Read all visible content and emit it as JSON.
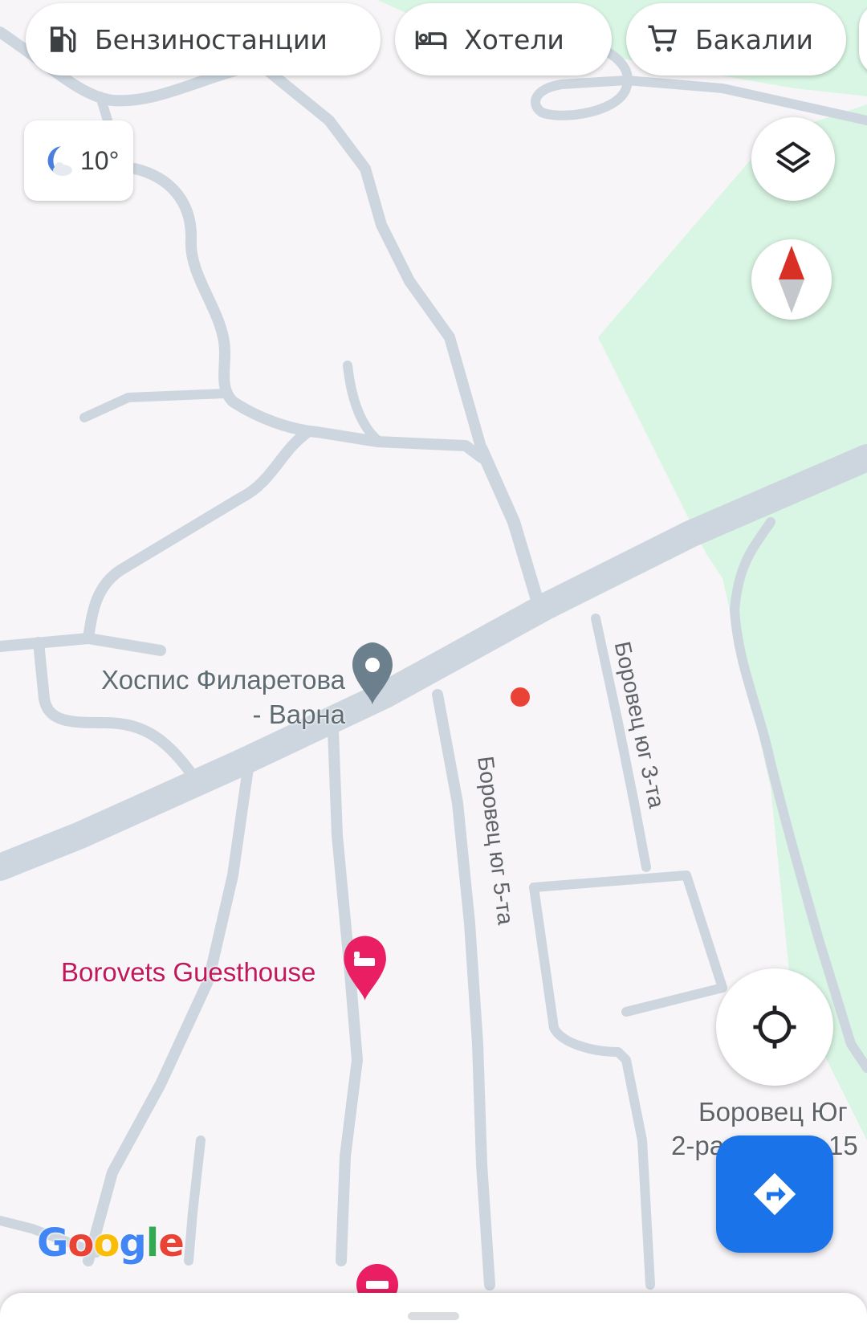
{
  "chips": [
    {
      "label": "Бензиностанции",
      "icon": "gas-station-icon"
    },
    {
      "label": "Хотели",
      "icon": "hotel-bed-icon"
    },
    {
      "label": "Бакалии",
      "icon": "shopping-cart-icon"
    }
  ],
  "weather": {
    "temp": "10°",
    "icon": "moon-cloud-icon"
  },
  "poi": {
    "hospice_line1": "Хоспис Филаретова",
    "hospice_line2": "- Варна",
    "guesthouse": "Borovets Guesthouse",
    "borovets_yug_line1": "Боровец Юг",
    "borovets_yug_line2a": "2-ра",
    "borovets_yug_line2b": "15"
  },
  "streets": {
    "yug3": "Боровец юг 3-та",
    "yug5": "Боровец юг 5-та"
  },
  "logo": {
    "letters": [
      "G",
      "o",
      "o",
      "g",
      "l",
      "e"
    ],
    "colors": [
      "#4285F4",
      "#EA4335",
      "#FBBC05",
      "#4285F4",
      "#34A853",
      "#EA4335"
    ]
  },
  "colors": {
    "road": "#cdd6df",
    "park": "#d9f5e3",
    "land": "#f7f5f7",
    "accent": "#1a73e8",
    "marker": "#ea4335"
  }
}
